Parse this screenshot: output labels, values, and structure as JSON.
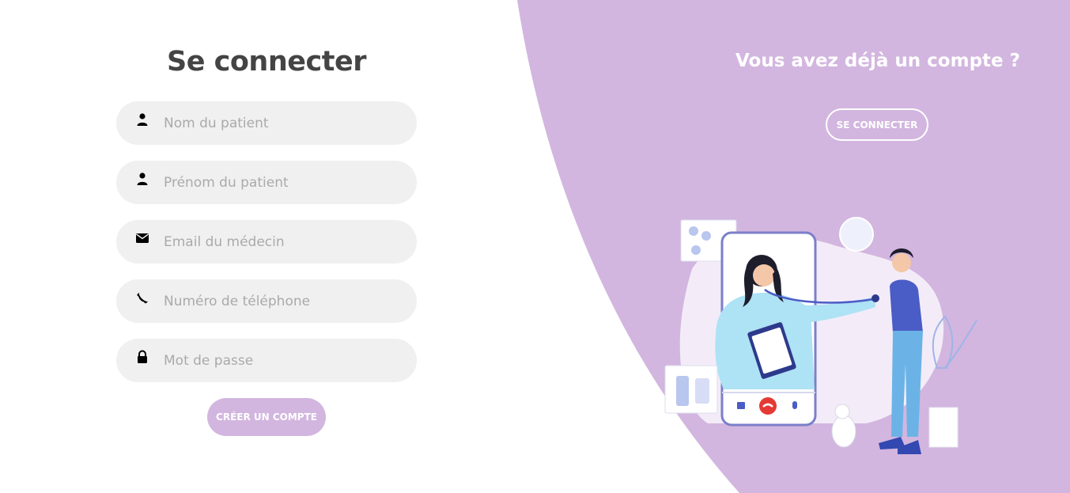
{
  "colors": {
    "panel_purple": "#d2b6df",
    "field_bg": "#f0f0f0",
    "title_text": "#444444",
    "placeholder_text": "#aaaaaa"
  },
  "signup_form": {
    "title": "Se connecter",
    "fields": [
      {
        "icon": "user-icon",
        "placeholder": "Nom du patient",
        "value": ""
      },
      {
        "icon": "user-icon",
        "placeholder": "Prénom du patient",
        "value": ""
      },
      {
        "icon": "envelope-icon",
        "placeholder": "Email du médecin",
        "value": ""
      },
      {
        "icon": "phone-icon",
        "placeholder": "Numéro de téléphone",
        "value": ""
      },
      {
        "icon": "lock-icon",
        "placeholder": "Mot de passe",
        "value": ""
      }
    ],
    "submit_label": "CRÉER UN COMPTE"
  },
  "right_panel": {
    "title": "Vous avez déjà un compte ?",
    "button_label": "SE CONNECTER",
    "illustration": "doctor-video-consultation-illustration"
  }
}
